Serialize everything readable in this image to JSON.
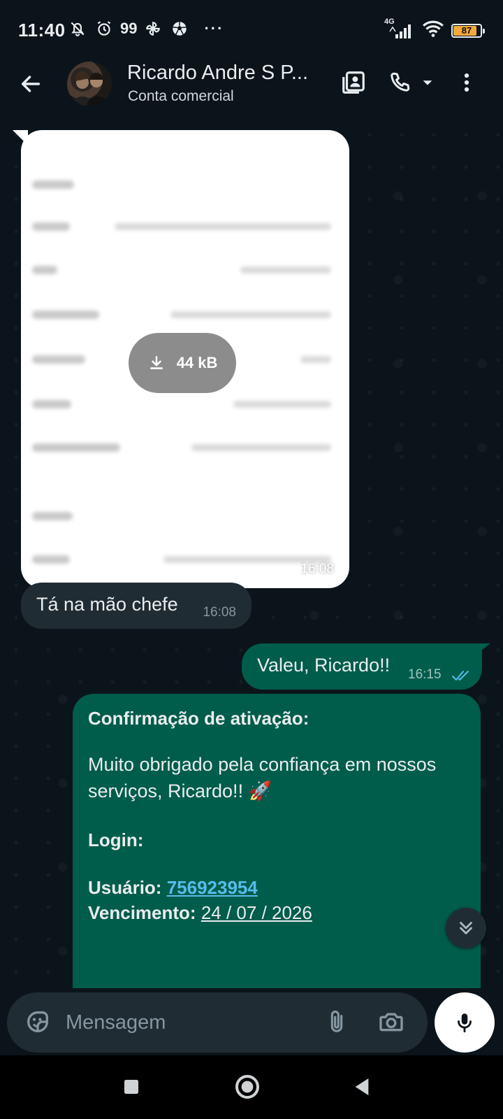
{
  "status_bar": {
    "time": "11:40",
    "num_badge": "99",
    "more": "···",
    "network": "4G",
    "battery": "87",
    "battery_level": 0.87
  },
  "header": {
    "contact_name": "Ricardo Andre S P...",
    "subtitle": "Conta comercial"
  },
  "messages": {
    "document": {
      "size_label": "44 kB",
      "time": "16:08"
    },
    "incoming": {
      "text": "Tá na mão chefe",
      "time": "16:08"
    },
    "outgoing": {
      "text": "Valeu, Ricardo!!",
      "time": "16:15",
      "status": "read"
    },
    "confirmation": {
      "title": "Confirmação de ativação:",
      "body": "Muito obrigado pela confiança em nossos serviços, Ricardo!! 🚀",
      "login_label": "Login:",
      "user_label": "Usuário:",
      "user_value": "756923954",
      "due_label": "Vencimento:",
      "due_value": "24 / 07 / 2026"
    }
  },
  "composer": {
    "placeholder": "Mensagem"
  },
  "colors": {
    "background": "#0b141a",
    "incoming_bubble": "#202c33",
    "outgoing_bubble": "#005c4b",
    "link": "#53bdeb",
    "read_ticks": "#53bdeb"
  },
  "icons": {
    "status": [
      "dnd-off-icon",
      "alarm-icon",
      "pinwheel-icon",
      "soccer-ball-icon"
    ],
    "header": [
      "back-arrow-icon",
      "contact-card-icon",
      "phone-icon",
      "chevron-down-icon",
      "more-vert-icon"
    ],
    "composer": [
      "sticker-icon",
      "paperclip-icon",
      "camera-icon",
      "mic-icon"
    ],
    "nav": [
      "recents-square-icon",
      "home-circle-icon",
      "back-triangle-icon"
    ]
  }
}
